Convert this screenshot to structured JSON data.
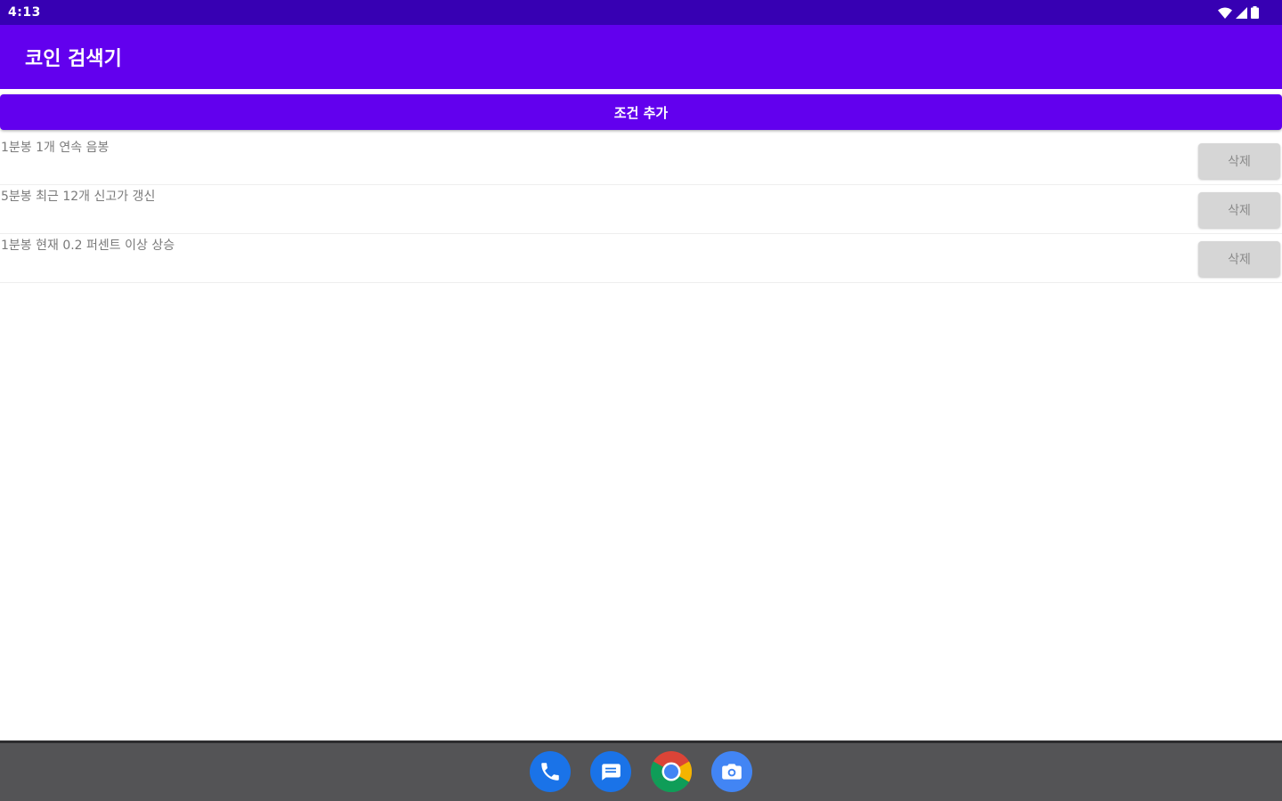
{
  "status_bar": {
    "time": "4:13",
    "icons": [
      "wifi-icon",
      "signal-icon",
      "battery-icon"
    ]
  },
  "app_bar": {
    "title": "코인 검색기"
  },
  "actions": {
    "add_label": "조건 추가"
  },
  "conditions": [
    {
      "text": "1분봉 1개 연속 음봉",
      "delete_label": "삭제"
    },
    {
      "text": "5분봉 최근 12개 신고가 갱신",
      "delete_label": "삭제"
    },
    {
      "text": "1분봉 현재 0.2 퍼센트 이상 상승",
      "delete_label": "삭제"
    }
  ],
  "dock": {
    "apps": [
      "phone-icon",
      "messages-icon",
      "chrome-icon",
      "camera-icon"
    ]
  },
  "colors": {
    "status_bar": "#3700b3",
    "primary": "#6200ee",
    "delete_button": "#d6d6d6",
    "dock": "#545456"
  }
}
